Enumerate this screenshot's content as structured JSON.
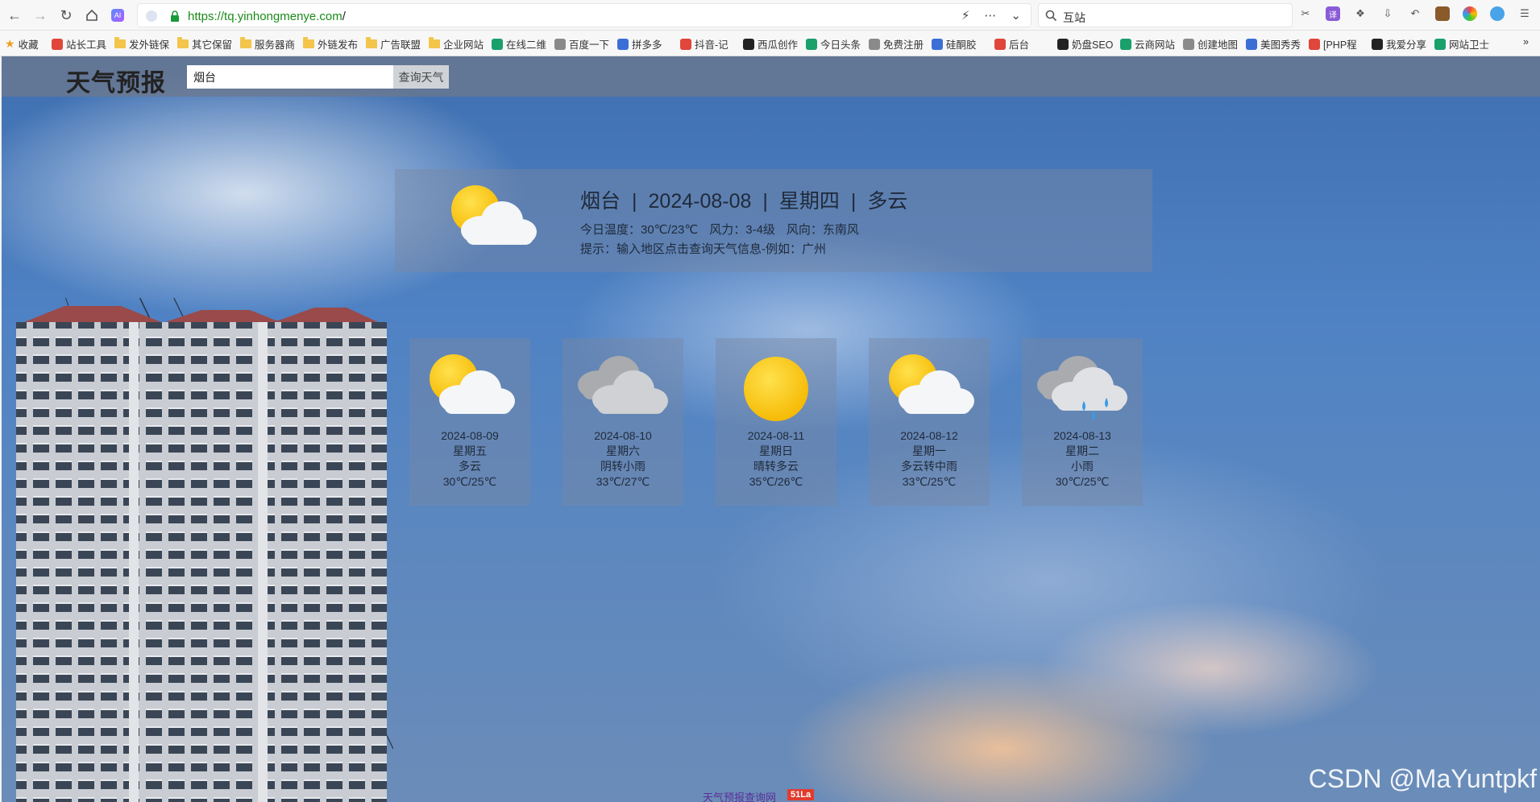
{
  "browser": {
    "url_scheme_host": "https://tq.yinhongmenye.com",
    "url_path": "/",
    "search_text": "互站"
  },
  "bookmarks": [
    {
      "label": "收藏",
      "icon": "star-icon"
    },
    {
      "label": "站长工具",
      "icon": "tool-icon"
    },
    {
      "label": "发外链保",
      "icon": "folder-icon"
    },
    {
      "label": "其它保留",
      "icon": "folder-icon"
    },
    {
      "label": "服务器商",
      "icon": "folder-icon"
    },
    {
      "label": "外链发布",
      "icon": "folder-icon"
    },
    {
      "label": "广告联盟",
      "icon": "folder-icon"
    },
    {
      "label": "企业网站",
      "icon": "folder-icon"
    },
    {
      "label": "在线二维",
      "icon": "qr-icon"
    },
    {
      "label": "百度一下",
      "icon": "baidu-icon"
    },
    {
      "label": "拼多多",
      "icon": "globe-icon"
    },
    {
      "label": "抖音-记",
      "icon": "douyin-icon"
    },
    {
      "label": "西瓜创作",
      "icon": "xigua-icon"
    },
    {
      "label": "今日头条",
      "icon": "toutiao-icon"
    },
    {
      "label": "免费注册",
      "icon": "globe-icon"
    },
    {
      "label": "硅酮胶",
      "icon": "link-icon"
    },
    {
      "label": "后台",
      "icon": "link-icon"
    },
    {
      "label": "奶盘SEO",
      "icon": "seo-icon"
    },
    {
      "label": "云商网站",
      "icon": "cloud-icon"
    },
    {
      "label": "创建地图",
      "icon": "map-icon"
    },
    {
      "label": "美图秀秀",
      "icon": "meitu-icon"
    },
    {
      "label": "[PHP程",
      "icon": "globe-icon"
    },
    {
      "label": "我爱分享",
      "icon": "share-icon"
    },
    {
      "label": "网站卫士",
      "icon": "globe-icon"
    }
  ],
  "site": {
    "title": "天气预报",
    "search_value": "烟台",
    "search_button": "查询天气"
  },
  "today": {
    "city": "烟台",
    "date": "2024-08-08",
    "weekday": "星期四",
    "condition": "多云",
    "temp": "今日温度：30℃/23℃",
    "wind_force": "风力：3-4级",
    "wind_dir": "风向：东南风",
    "tip": "提示：输入地区点击查询天气信息-例如：广州",
    "separator": "|",
    "icon": "partly-cloudy-icon"
  },
  "forecast": [
    {
      "date": "2024-08-09",
      "weekday": "星期五",
      "condition": "多云",
      "temp": "30℃/25℃",
      "icon": "partly-cloudy-icon"
    },
    {
      "date": "2024-08-10",
      "weekday": "星期六",
      "condition": "阴转小雨",
      "temp": "33℃/27℃",
      "icon": "overcast-icon"
    },
    {
      "date": "2024-08-11",
      "weekday": "星期日",
      "condition": "晴转多云",
      "temp": "35℃/26℃",
      "icon": "sunny-icon"
    },
    {
      "date": "2024-08-12",
      "weekday": "星期一",
      "condition": "多云转中雨",
      "temp": "33℃/25℃",
      "icon": "partly-cloudy-icon"
    },
    {
      "date": "2024-08-13",
      "weekday": "星期二",
      "condition": "小雨",
      "temp": "30℃/25℃",
      "icon": "light-rain-icon"
    }
  ],
  "footer": {
    "link": "天气预报查询网",
    "badge": "51La"
  },
  "watermark": "CSDN @MaYuntpkf"
}
